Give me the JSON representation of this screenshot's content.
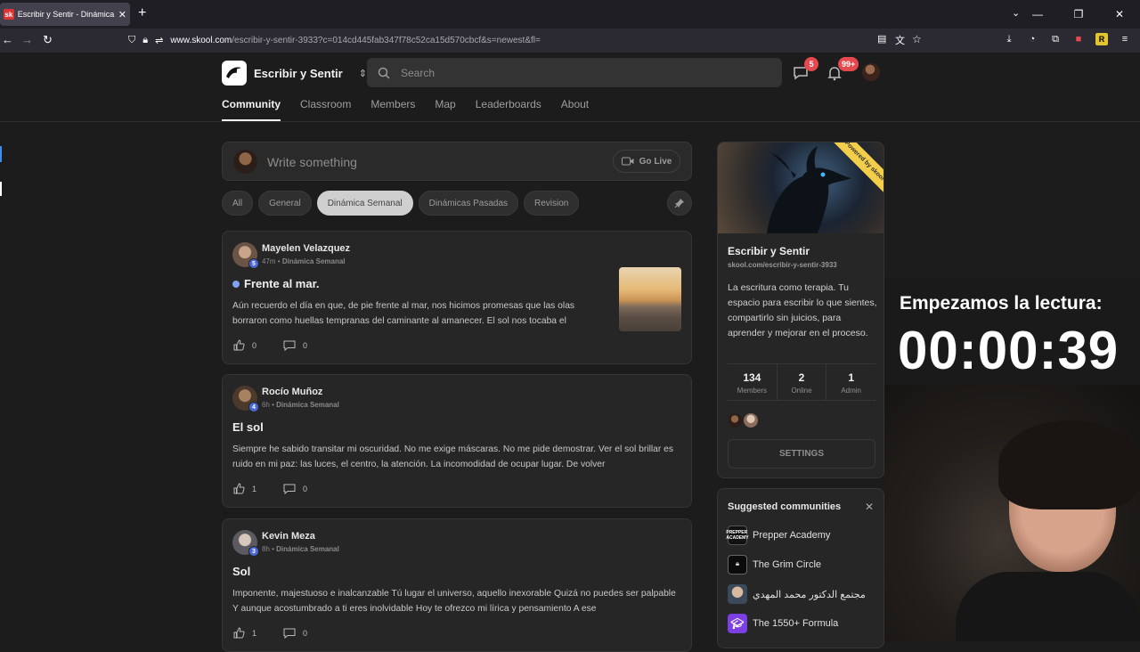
{
  "browser": {
    "tab_title": "Escribir y Sentir - Dinámica Semanal",
    "tab_favicon": "sk",
    "url_domain": "www.skool.com",
    "url_path": "/escribir-y-sentir-3933?c=014cd445fab347f78c52ca15d570cbcf&s=newest&fl="
  },
  "header": {
    "community_name": "Escribir y Sentir",
    "search_placeholder": "Search",
    "chat_badge": "5",
    "notif_badge": "99+"
  },
  "nav_tabs": [
    {
      "label": "Community",
      "active": true
    },
    {
      "label": "Classroom"
    },
    {
      "label": "Members"
    },
    {
      "label": "Map"
    },
    {
      "label": "Leaderboards"
    },
    {
      "label": "About"
    }
  ],
  "composer": {
    "placeholder": "Write something",
    "go_live_label": "Go Live"
  },
  "filters": [
    {
      "label": "All"
    },
    {
      "label": "General"
    },
    {
      "label": "Dinámica Semanal",
      "active": true
    },
    {
      "label": "Dinámicas Pasadas"
    },
    {
      "label": "Revision"
    }
  ],
  "posts": [
    {
      "author": "Mayelen Velazquez",
      "level": "5",
      "time": "47m",
      "category": "Dinámica Semanal",
      "title": "Frente al mar.",
      "body": "Aún recuerdo el día en que, de pie frente al mar, nos hicimos promesas que las olas borraron como huellas tempranas del caminante al amanecer. El sol nos tocaba el",
      "likes": "0",
      "comments": "0"
    },
    {
      "author": "Rocío Muñoz",
      "level": "4",
      "time": "6h",
      "category": "Dinámica Semanal",
      "title": "El sol",
      "body": "Siempre he sabido transitar mi oscuridad. No me exige máscaras. No me pide demostrar. Ver el sol brillar es ruido en mi paz: las luces, el centro, la atención. La incomodidad de ocupar lugar. De volver",
      "likes": "1",
      "comments": "0"
    },
    {
      "author": "Kevin Meza",
      "level": "3",
      "time": "8h",
      "category": "Dinámica Semanal",
      "title": "Sol",
      "body": "Imponente, majestuoso e inalcanzable Tú lugar el universo, aquello inexorable Quizá no puedes ser palpable Y aunque acostumbrado a ti eres inolvidable Hoy te ofrezco mi lírica y pensamiento A ese",
      "likes": "1",
      "comments": "0"
    }
  ],
  "sidebar": {
    "ribbon": "Powered by skool",
    "name": "Escribir y Sentir",
    "url": "skool.com/escribir-y-sentir-3933",
    "description": "La escritura como terapia. Tu espacio para escribir lo que sientes, compartirlo sin juicios, para aprender y mejorar en el proceso.",
    "stats": [
      {
        "value": "134",
        "label": "Members"
      },
      {
        "value": "2",
        "label": "Online"
      },
      {
        "value": "1",
        "label": "Admin"
      }
    ],
    "settings_label": "SETTINGS"
  },
  "suggested": {
    "title": "Suggested communities",
    "items": [
      {
        "name": "Prepper Academy",
        "icon_text": "PREPPER ACADEMY"
      },
      {
        "name": "The Grim Circle"
      },
      {
        "name": "مجتمع الدكتور محمد المهدي"
      },
      {
        "name": "The 1550+ Formula"
      }
    ]
  },
  "overlay": {
    "timer_label": "Empezamos la lectura:",
    "timer_value": "00:00:39"
  },
  "colors": {
    "accent_badge": "#e5484d",
    "level_badge": "#4a68d9",
    "ribbon": "#f3ce4b"
  }
}
